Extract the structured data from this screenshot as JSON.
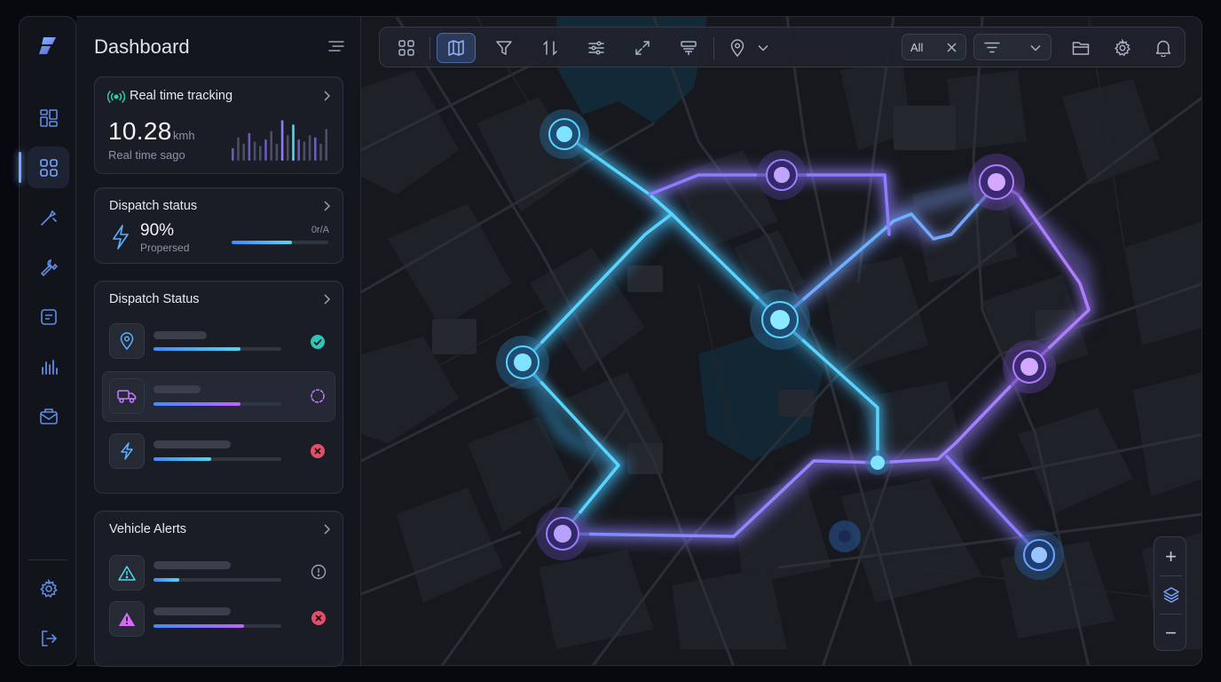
{
  "colors": {
    "accent_blue": "#5f8ce8",
    "route_cyan": "#58d4ff",
    "route_purple": "#9d7cff",
    "success": "#2ec4b6",
    "danger": "#e0506a",
    "background": "#07090f"
  },
  "rail": {
    "logo": "brand-logo",
    "items": [
      {
        "icon": "grid-icon",
        "active": false
      },
      {
        "icon": "dashboard-icon",
        "active": true
      },
      {
        "icon": "wrench-icon",
        "active": false
      },
      {
        "icon": "tool-icon",
        "active": false
      },
      {
        "icon": "document-icon",
        "active": false
      },
      {
        "icon": "bar-chart-icon",
        "active": false
      },
      {
        "icon": "mail-icon",
        "active": false
      }
    ],
    "bottom": [
      {
        "icon": "settings-icon"
      },
      {
        "icon": "logout-icon"
      }
    ]
  },
  "panel": {
    "title": "Dashboard",
    "tracking": {
      "title": "Real time tracking",
      "value": "10.28",
      "unit": "kmh",
      "subtitle": "Real time sago"
    },
    "dispatch": {
      "title": "Dispatch status",
      "percent": "90%",
      "caption": "Propersed",
      "right_label": "0r/A",
      "progress": 0.62
    },
    "dispatch_list": {
      "title": "Dispatch Status",
      "rows": [
        {
          "icon": "location-pin-icon",
          "progress": 0.68,
          "status": "check"
        },
        {
          "icon": "truck-icon",
          "progress": 0.68,
          "status": "pending"
        },
        {
          "icon": "bolt-icon",
          "progress": 0.45,
          "status": "error"
        }
      ]
    },
    "alerts": {
      "title": "Vehicle Alerts",
      "rows": [
        {
          "icon": "warning-icon",
          "progress": 0.2,
          "status": "info"
        },
        {
          "icon": "warning-filled-icon",
          "progress": 0.71,
          "status": "error"
        }
      ]
    }
  },
  "toolbar": {
    "buttons": [
      "grid-view-icon",
      "map-icon",
      "filter-icon",
      "sort-icon",
      "sliders-icon",
      "expand-icon",
      "layer-filter-icon",
      "location-icon"
    ],
    "active": "map-icon",
    "filter_value": "All",
    "right_buttons": [
      "folder-icon",
      "settings-icon",
      "bell-icon"
    ]
  },
  "zoom": {
    "in": "+",
    "layers": "layers-icon",
    "out": "−"
  }
}
